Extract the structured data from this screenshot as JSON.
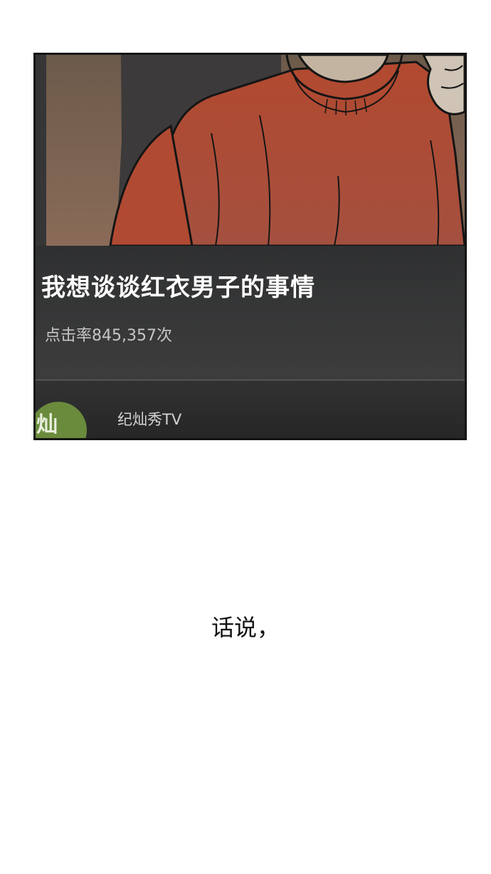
{
  "card": {
    "title": "我想谈谈红衣男子的事情",
    "views": "点击率845,357次",
    "channel": {
      "name": "纪灿秀TV",
      "avatar_text": "灿"
    }
  },
  "caption": "话说，",
  "colors": {
    "panel_bg": "#363637",
    "sweater": "#b4503b",
    "avatar_bg": "#6a8b3c"
  }
}
